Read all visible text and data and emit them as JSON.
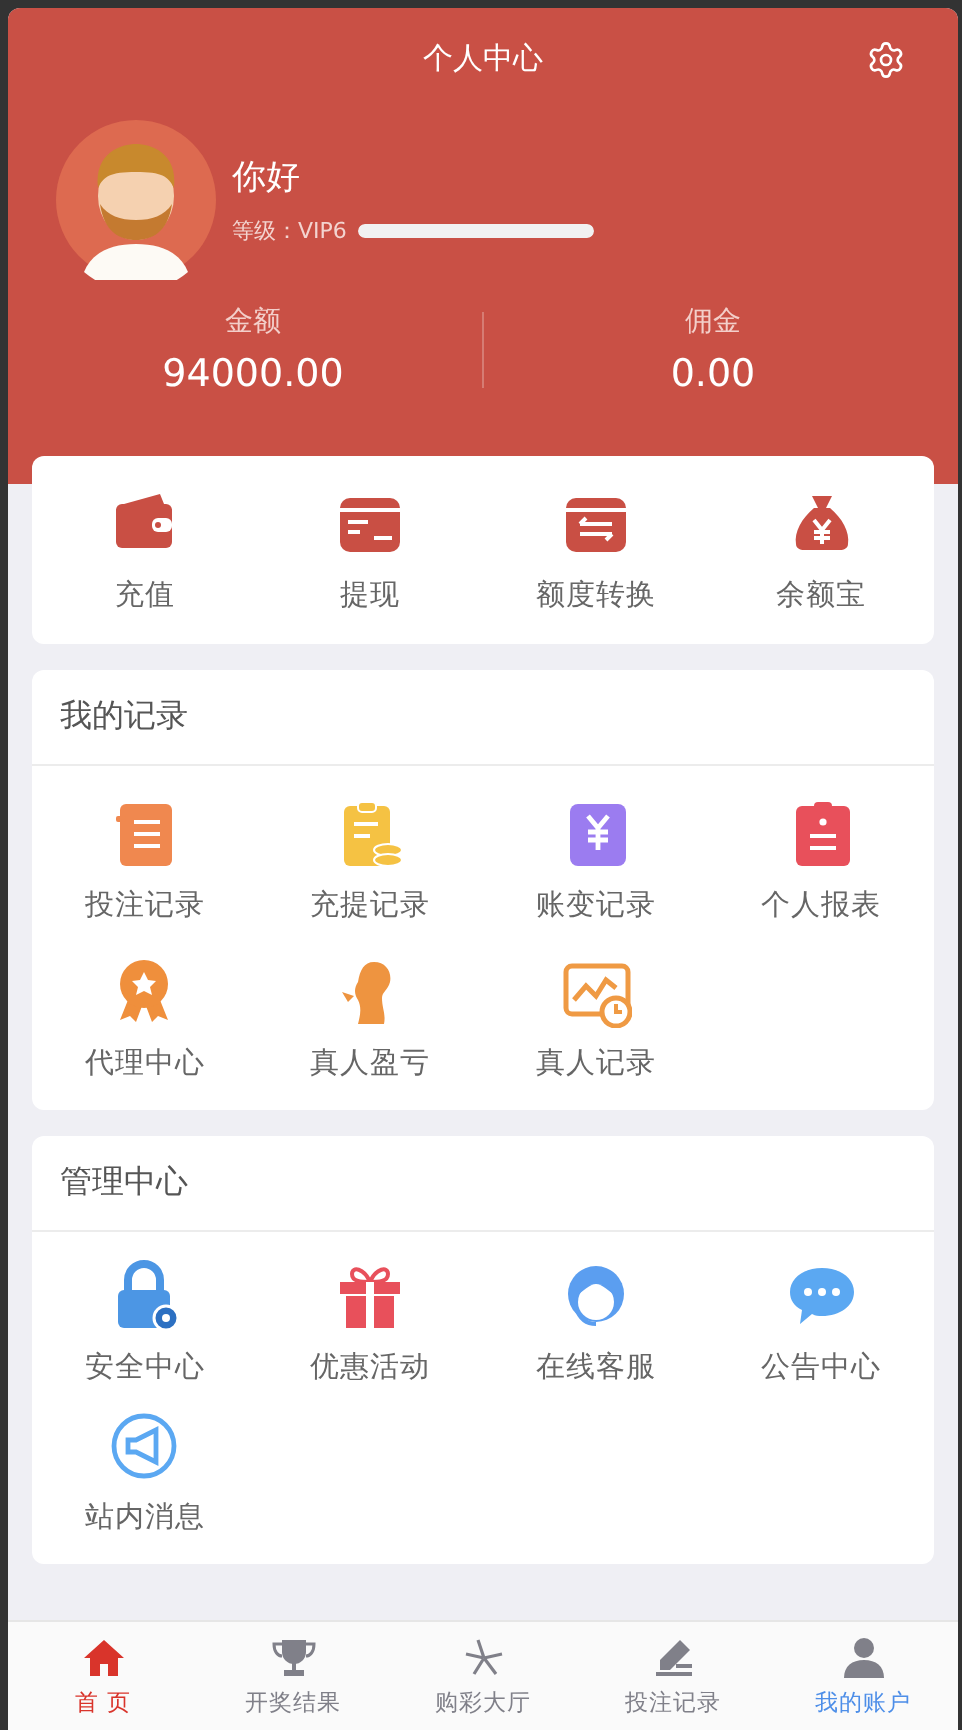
{
  "header": {
    "title": "个人中心",
    "greeting": "你好",
    "level_label": "等级：VIP6",
    "level": 1
  },
  "balances": [
    {
      "label": "金额",
      "value": "94000.00"
    },
    {
      "label": "佣金",
      "value": "0.00"
    }
  ],
  "quick_actions": [
    "充值",
    "提现",
    "额度转换",
    "余额宝"
  ],
  "records": {
    "title": "我的记录",
    "items": [
      "投注记录",
      "充提记录",
      "账变记录",
      "个人报表",
      "代理中心",
      "真人盈亏",
      "真人记录"
    ]
  },
  "management": {
    "title": "管理中心",
    "items": [
      "安全中心",
      "优惠活动",
      "在线客服",
      "公告中心",
      "站内消息"
    ]
  },
  "bottom_nav": [
    {
      "label": "首 页",
      "selected": false,
      "color": "#d9342b"
    },
    {
      "label": "开奖结果",
      "selected": false,
      "color": "#808089"
    },
    {
      "label": "购彩大厅",
      "selected": false,
      "color": "#808089"
    },
    {
      "label": "投注记录",
      "selected": false,
      "color": "#808089"
    },
    {
      "label": "我的账户",
      "selected": true,
      "color": "#808089"
    }
  ]
}
